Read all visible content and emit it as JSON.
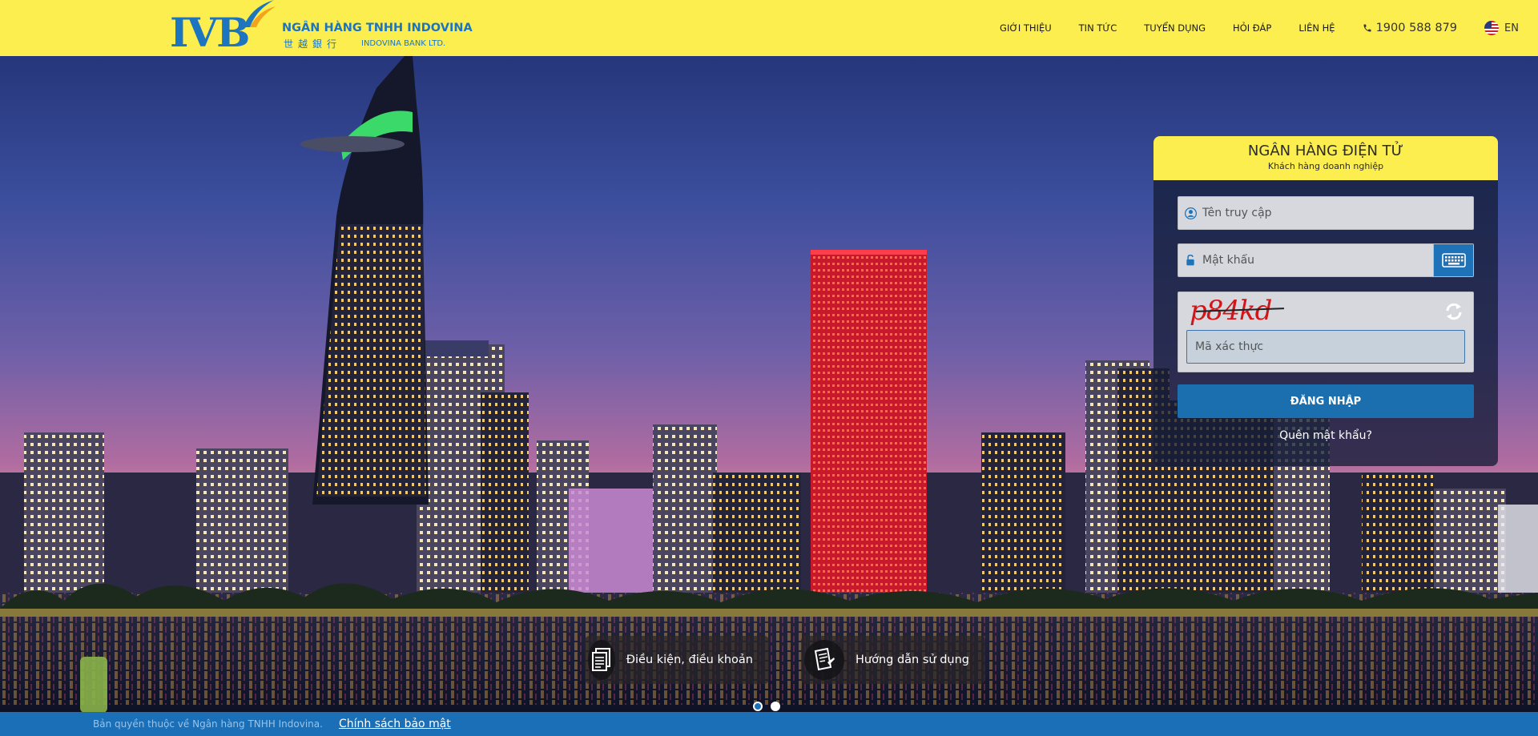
{
  "brand": {
    "logo_mark": "IVB",
    "name": "NGÂN HÀNG TNHH INDOVINA",
    "name_cn": "世越銀行",
    "name_en": "INDOVINA BANK LTD."
  },
  "nav": {
    "items": [
      "GIỚI THIỆU",
      "TIN TỨC",
      "TUYỂN DỤNG",
      "HỎI ĐÁP",
      "LIÊN HỆ"
    ],
    "phone": "1900 588 879",
    "language": "EN"
  },
  "login": {
    "title": "NGÂN HÀNG ĐIỆN TỬ",
    "subtitle": "Khách hàng doanh nghiệp",
    "username_placeholder": "Tên truy cập",
    "password_placeholder": "Mật khẩu",
    "captcha_text": "p84kd",
    "captcha_placeholder": "Mã xác thực",
    "submit_label": "ĐĂNG NHẬP",
    "forgot_label": "Quên mật khẩu?"
  },
  "actions": {
    "terms_label": "Điều kiện, điều khoản",
    "guide_label": "Hướng dẫn sử dụng"
  },
  "carousel": {
    "slides": 2,
    "active": 1
  },
  "footer": {
    "copyright": "Bản quyền thuộc về Ngân hàng TNHH Indovina.",
    "policy_link": "Chính sách bảo mật"
  },
  "colors": {
    "header_bg": "#fdee4f",
    "brand_blue": "#1d74bf",
    "button_blue": "#1b6faf",
    "footer_bg": "#1a6fb7"
  },
  "icons": {
    "phone": "phone-icon",
    "flag": "us-flag-icon",
    "user": "user-icon",
    "lock": "unlock-icon",
    "keyboard": "keyboard-icon",
    "refresh": "refresh-icon",
    "terms": "document-icon",
    "guide": "manual-icon"
  }
}
